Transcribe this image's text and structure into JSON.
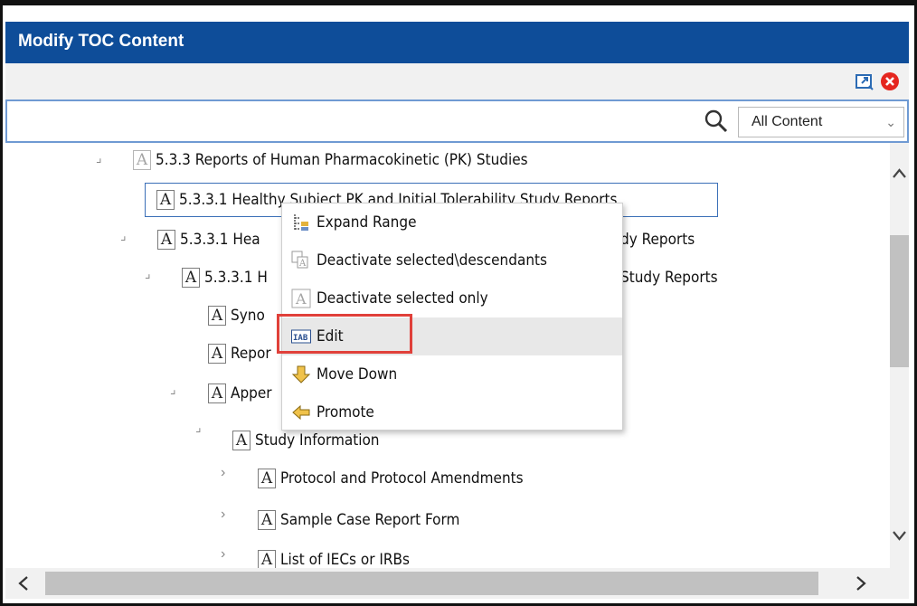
{
  "window": {
    "title": "Modify TOC Content"
  },
  "search": {
    "value": "",
    "placeholder": "",
    "filter_selected": "All Content"
  },
  "tree": {
    "nodes": [
      {
        "label": "5.3.3 Reports of Human Pharmacokinetic (PK) Studies",
        "twisty": "⌟"
      },
      {
        "label": "5.3.3.1 Healthy Subject PK and Initial Tolerability Study Reports"
      },
      {
        "label": "5.3.3.1 Hea",
        "label_tail": "dy Reports",
        "twisty": "⌟"
      },
      {
        "label": "5.3.3.1 H",
        "label_tail": "Study Reports",
        "twisty": "⌟"
      },
      {
        "label": "Syno"
      },
      {
        "label": "Repor"
      },
      {
        "label": "Apper",
        "twisty": "⌟"
      },
      {
        "label": "Study Information",
        "twisty": "⌟"
      },
      {
        "label": "Protocol and Protocol Amendments",
        "twisty": "›"
      },
      {
        "label": "Sample Case Report Form",
        "twisty": "›"
      },
      {
        "label": "List of IECs or IRBs",
        "twisty": "›"
      }
    ]
  },
  "context_menu": {
    "items": [
      {
        "label": "Expand Range",
        "icon": "expand-range-icon"
      },
      {
        "label": "Deactivate selected\\descendants",
        "icon": "deactivate-descendants-icon"
      },
      {
        "label": "Deactivate selected only",
        "icon": "deactivate-only-icon"
      },
      {
        "label": "Edit",
        "icon": "edit-text-icon"
      },
      {
        "label": "Move Down",
        "icon": "arrow-down-icon"
      },
      {
        "label": "Promote",
        "icon": "arrow-left-icon"
      }
    ]
  },
  "colors": {
    "title_bar": "#0e4d99",
    "highlight": "#e0403a",
    "selection_border": "#3a6fb7"
  },
  "icons": {
    "doc": "A"
  }
}
